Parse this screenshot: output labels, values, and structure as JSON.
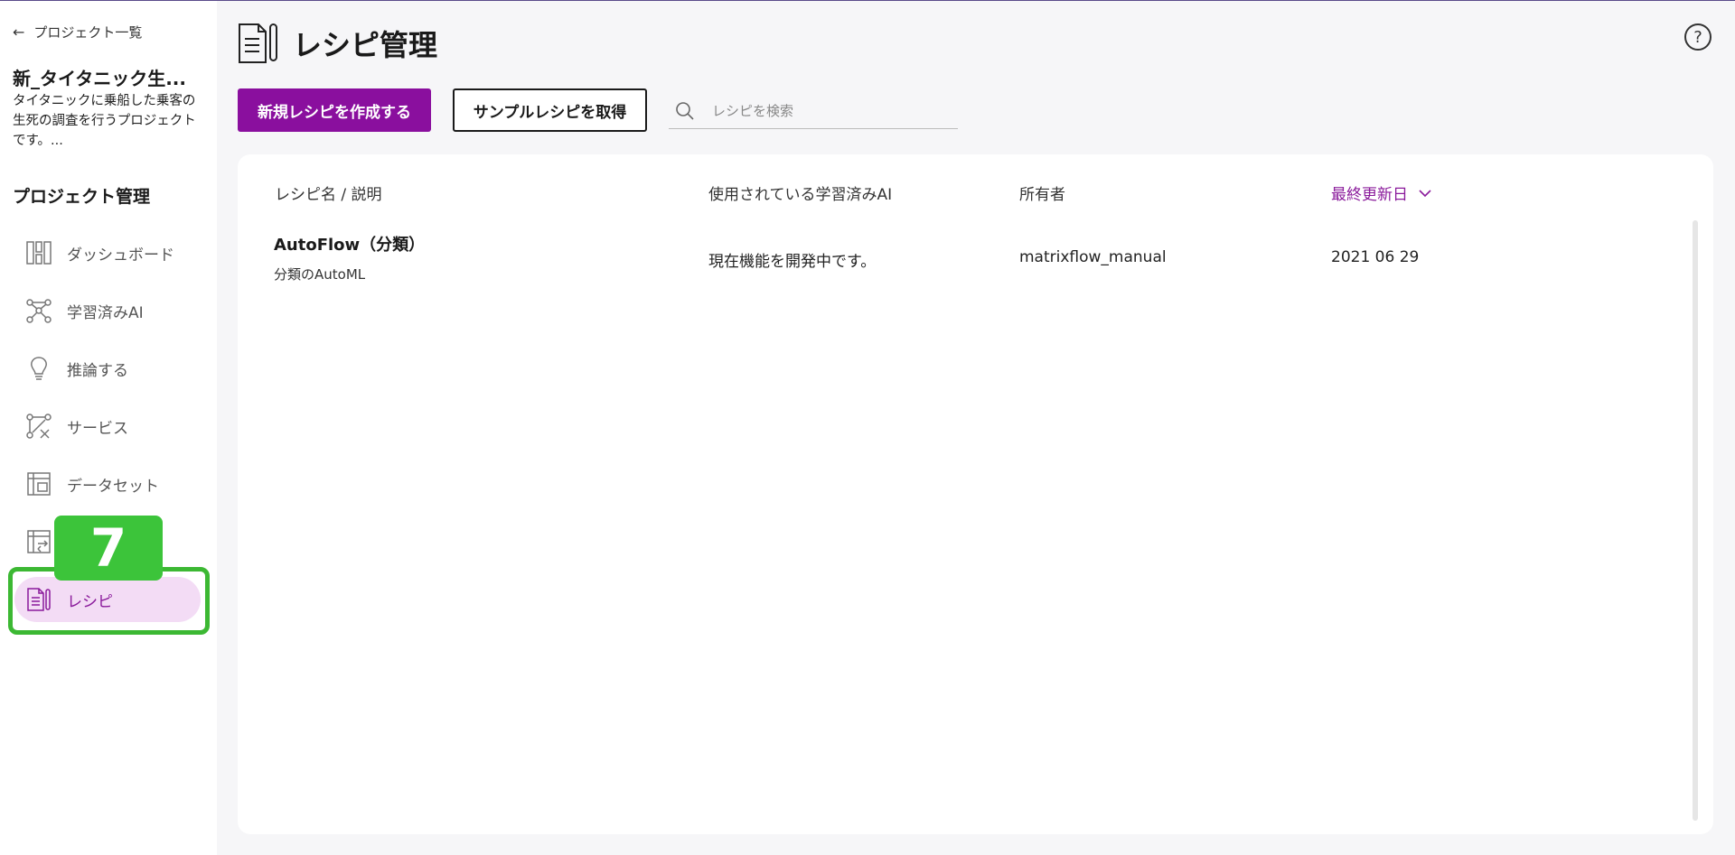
{
  "sidebar": {
    "back_label": "プロジェクト一覧",
    "project_name": "新_タイタニック生...",
    "project_desc": "タイタニックに乗船した乗客の生死の調査を行うプロジェクトです。...",
    "section_title": "プロジェクト管理",
    "items": [
      {
        "label": "ダッシュボード",
        "icon": "dashboard-icon"
      },
      {
        "label": "学習済みAI",
        "icon": "network-icon"
      },
      {
        "label": "推論する",
        "icon": "lightbulb-icon"
      },
      {
        "label": "サービス",
        "icon": "service-icon"
      },
      {
        "label": "データセット",
        "icon": "dataset-icon"
      },
      {
        "label": "",
        "icon": "table-convert-icon"
      },
      {
        "label": "レシピ",
        "icon": "recipe-icon",
        "active": true
      }
    ],
    "step_badge": "7"
  },
  "header": {
    "title": "レシピ管理",
    "create_button": "新規レシピを作成する",
    "sample_button": "サンプルレシピを取得",
    "search_placeholder": "レシピを検索"
  },
  "table": {
    "columns": [
      "レシピ名 / 説明",
      "使用されている学習済みAI",
      "所有者",
      "最終更新日"
    ],
    "rows": [
      {
        "name": "AutoFlow（分類）",
        "desc": "分類のAutoML",
        "model": "現在機能を開発中です。",
        "owner": "matrixflow_manual",
        "updated": "2021 06 29"
      }
    ]
  },
  "colors": {
    "accent": "#8a0f9e",
    "active_bg": "#f3dcf5",
    "highlight": "#3cb833"
  }
}
